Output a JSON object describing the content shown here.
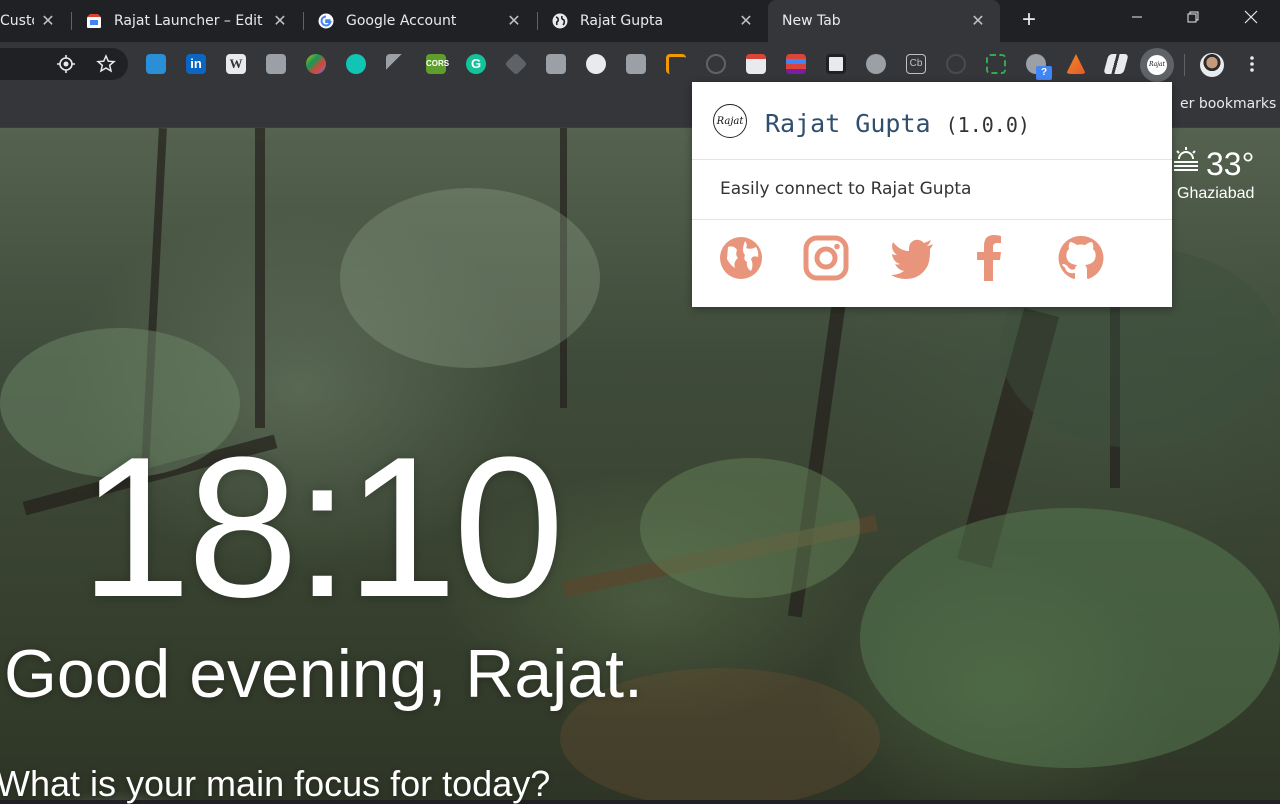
{
  "tabs": [
    {
      "title": "Custo",
      "active": false
    },
    {
      "title": "Rajat Launcher – Edit it",
      "active": false
    },
    {
      "title": "Google Account",
      "active": false
    },
    {
      "title": "Rajat Gupta",
      "active": false
    },
    {
      "title": "New Tab",
      "active": true
    }
  ],
  "bookmarks_bar": {
    "other_bookmarks": "er bookmarks"
  },
  "newtab": {
    "time": "18:10",
    "greeting": "Good evening, Rajat.",
    "focus_prompt": "What is your main focus for today?",
    "weather": {
      "temp": "33°",
      "location": "Ghaziabad",
      "icon": "haze-sun-icon"
    }
  },
  "popup": {
    "logo_text": "Rajat",
    "name": "Rajat Gupta",
    "version": "(1.0.0)",
    "description": "Easily connect to Rajat Gupta",
    "links": [
      "website-globe-icon",
      "instagram-icon",
      "twitter-icon",
      "facebook-icon",
      "github-icon"
    ],
    "accent_color": "#e8957c"
  },
  "extension_badge": "?"
}
